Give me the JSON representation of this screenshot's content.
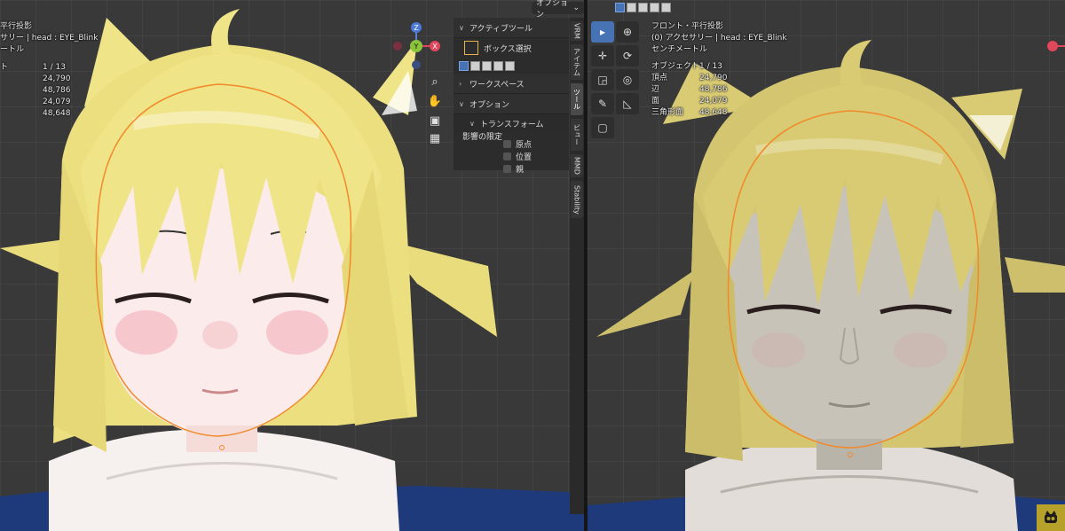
{
  "colors": {
    "viewport_bg": "#393939",
    "hair": "#f0e488",
    "hair_right": "#d9cb74",
    "skin": "#fbeceb",
    "skin_right": "#c8c3b8",
    "blush": "#f4b8c0",
    "selection_outline": "#f08a2a",
    "jacket": "#1e3a7a",
    "hood": "#f6f1ee",
    "active_blue": "#4772b3"
  },
  "left": {
    "overlay": {
      "line1": "平行投影",
      "line2": "サリー | head : EYE_Blink",
      "line3": "ートル",
      "objects_label": "ト",
      "objects_value": "1 / 13",
      "stats": [
        "24,790",
        "48,786",
        "24,079",
        "48,648"
      ]
    },
    "gizmo": {
      "z": "Z",
      "y": "Y",
      "x": "X"
    },
    "nav_icons": [
      "zoom-icon",
      "hand-icon",
      "camera-icon",
      "grid-icon"
    ],
    "options_button": "オプション",
    "npanel": {
      "active_tool_header": "アクティブツール",
      "box_select": "ボックス選択",
      "workspace_header": "ワークスペース",
      "options_header": "オプション",
      "transform_header": "トランスフォーム",
      "affect_only": "影響の限定",
      "checkboxes": [
        "原点",
        "位置",
        "親"
      ]
    },
    "tabs": [
      "VRM",
      "アイテム",
      "ツール",
      "ビュー",
      "MMD",
      "Stability"
    ]
  },
  "right": {
    "overlay": {
      "line1": "フロント・平行投影",
      "line2": "(0) アクセサリー | head : EYE_Blink",
      "line3": "センチメートル",
      "objects_label": "オブジェクト",
      "objects_value": "1 / 13",
      "stats": [
        {
          "k": "頂点",
          "v": "24,790"
        },
        {
          "k": "辺",
          "v": "48,786"
        },
        {
          "k": "面",
          "v": "24,079"
        },
        {
          "k": "三角形面",
          "v": "48,648"
        }
      ]
    },
    "toolbar_icons": [
      "select-cursor-icon",
      "cursor-icon",
      "move-icon",
      "rotate-icon",
      "scale-icon",
      "transform-icon",
      "annotate-icon",
      "measure-icon",
      "add-cube-icon"
    ]
  }
}
